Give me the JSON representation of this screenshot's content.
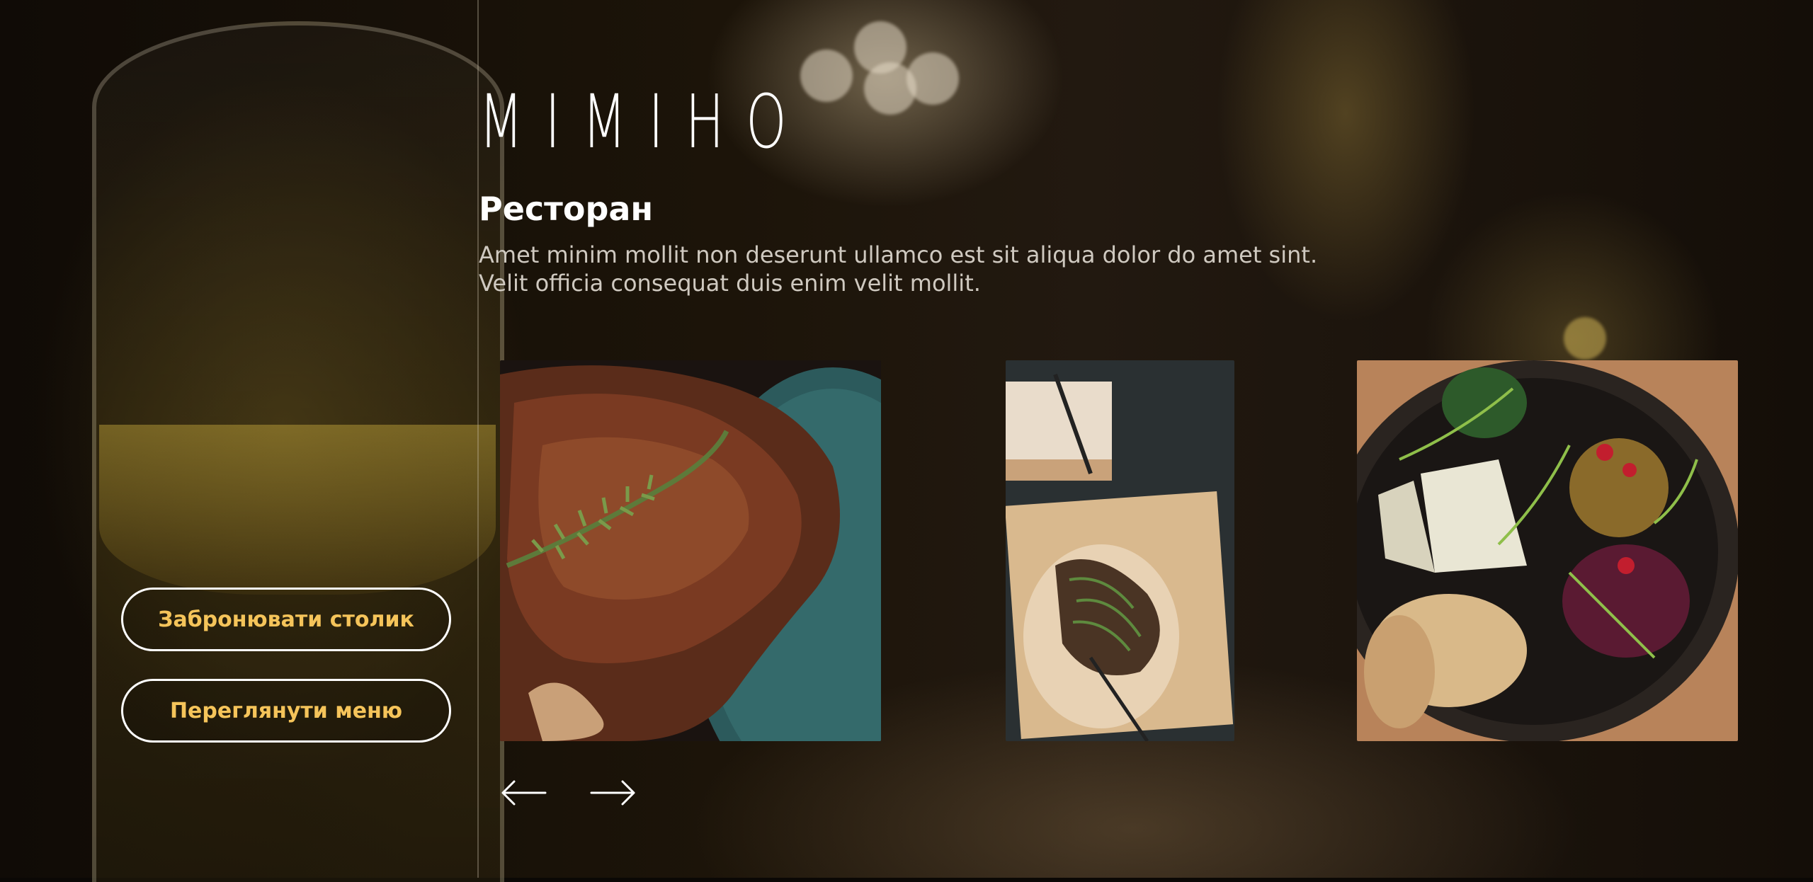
{
  "brand": {
    "logo_text": "MIMIHO"
  },
  "hero": {
    "title": "Ресторан",
    "description": "Amet minim mollit non deserunt ullamco est sit aliqua dolor do amet sint. Velit officia consequat duis enim velit mollit."
  },
  "actions": {
    "book_label": "Забронювати столик",
    "menu_label": "Переглянути меню"
  },
  "gallery": {
    "items": [
      {
        "subject": "grilled steak with rosemary"
      },
      {
        "subject": "kebab skewers on flatbread board"
      },
      {
        "subject": "salad bowl with cheese and bread"
      }
    ],
    "prev_icon": "arrow-left-icon",
    "next_icon": "arrow-right-icon"
  },
  "colors": {
    "accent": "#f5c45a",
    "text": "#ffffff",
    "muted_text": "#cfc9c0"
  }
}
